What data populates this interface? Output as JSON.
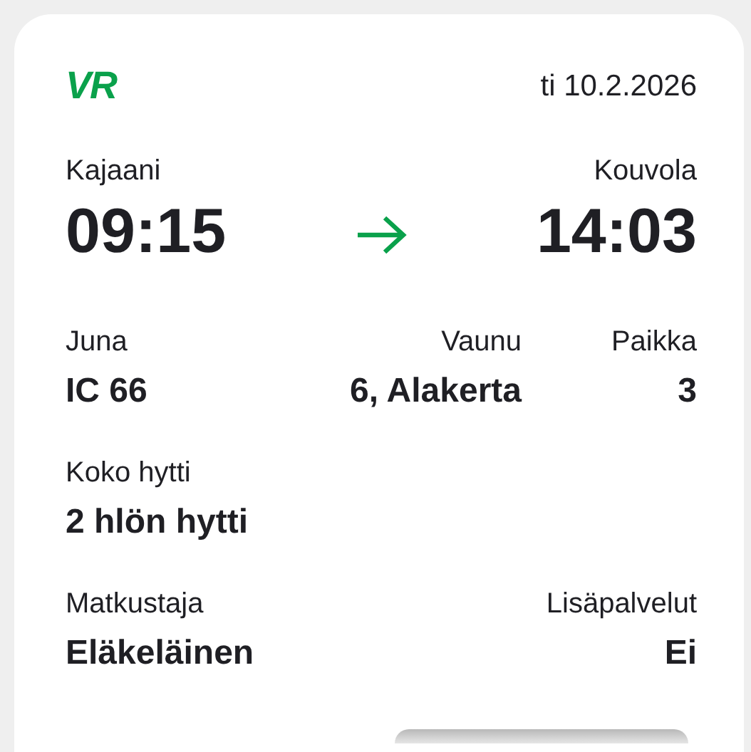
{
  "logo": "VR",
  "date": "ti 10.2.2026",
  "departure": {
    "station": "Kajaani",
    "time": "09:15"
  },
  "arrival": {
    "station": "Kouvola",
    "time": "14:03"
  },
  "details": [
    {
      "label": "Juna",
      "value": "IC 66"
    },
    {
      "label": "Vaunu",
      "value": "6, Alakerta"
    },
    {
      "label": "Paikka",
      "value": "3"
    }
  ],
  "cabin": {
    "label": "Koko hytti",
    "value": "2 hlön hytti"
  },
  "passenger": {
    "label": "Matkustaja",
    "value": "Eläkeläinen"
  },
  "extras": {
    "label": "Lisäpalvelut",
    "value": "Ei"
  }
}
